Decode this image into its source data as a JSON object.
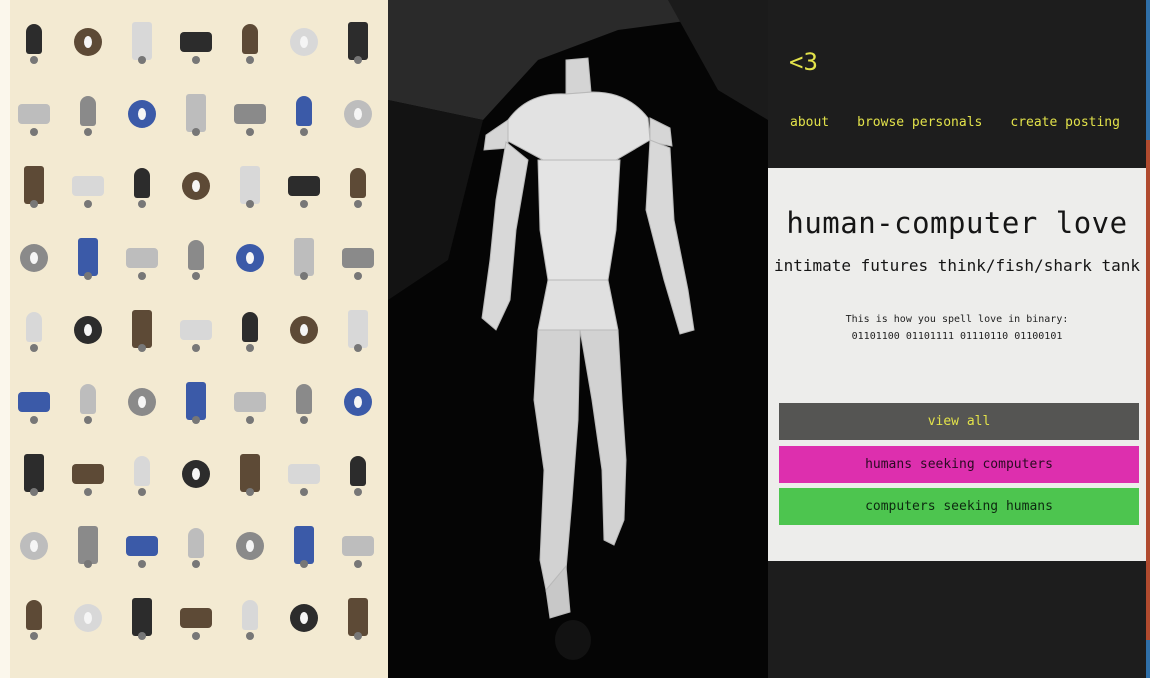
{
  "site": {
    "logo": "<3",
    "nav": [
      "about",
      "browse personals",
      "create posting"
    ],
    "title": "human-computer love",
    "subtitle": "intimate futures think/fish/shark tank",
    "binary_intro": "This is how you spell love in binary:",
    "binary_code": "01101100 01101111 01110110 01100101",
    "buttons": {
      "view_all": "view all",
      "humans_seeking_computers": "humans seeking computers",
      "computers_seeking_humans": "computers seeking humans"
    }
  },
  "colors": {
    "accent_yellow": "#e2e24a",
    "site_background": "#1d1d1d",
    "card_background": "#ededeb",
    "view_all": "#555553",
    "humans_seeking_computers": "#dd2fae",
    "computers_seeking_humans": "#4dc54f",
    "catalog_paper": "#f3ead2"
  },
  "catalog": {
    "items": [
      "camera-bulb-icon",
      "flood-bulb-icon",
      "wall-lamp-icon",
      "desk-lamp-icon",
      "lantern-icon",
      "spotlight-icon",
      "security-light-icon",
      "solar-light-icon"
    ]
  }
}
